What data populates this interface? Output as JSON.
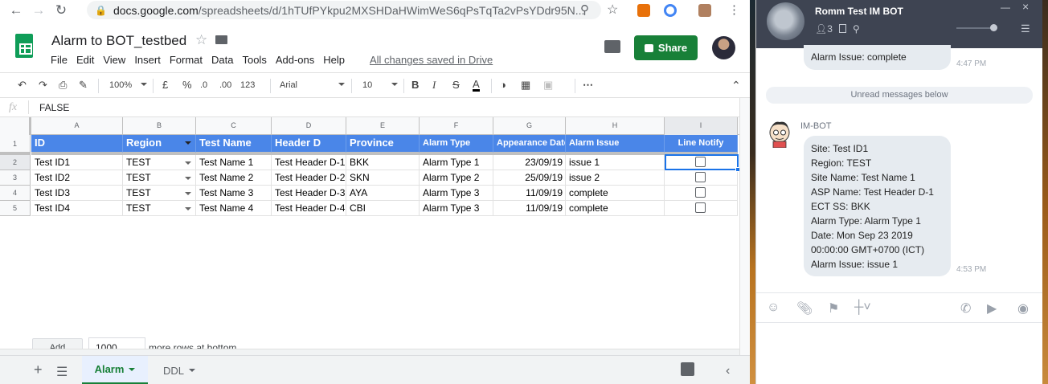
{
  "browser": {
    "url_host": "docs.google.com",
    "url_path": "/spreadsheets/d/1hTUfPYkpu2MXSHDaHWimWeS6qPsTqTa2vPsYDdr95N...",
    "icons": [
      "back-arrow-icon",
      "forward-arrow-icon",
      "reload-icon",
      "lock-icon",
      "zoom-icon",
      "star-icon",
      "kebab-menu-icon"
    ]
  },
  "sheet": {
    "title": "Alarm to BOT_testbed",
    "menu": [
      "File",
      "Edit",
      "View",
      "Insert",
      "Format",
      "Data",
      "Tools",
      "Add-ons",
      "Help"
    ],
    "saved_status": "All changes saved in Drive",
    "share_label": "Share",
    "toolbar": {
      "zoom": "100%",
      "currency": "£",
      "percent": "%",
      "dec_less": ".0",
      "dec_more": ".00",
      "format_more": "123",
      "font": "Arial",
      "font_size": "10",
      "bold": "B",
      "italic": "I",
      "strike": "S",
      "text_color": "A",
      "more": "⋯"
    },
    "formula": {
      "fx": "fx",
      "value": "FALSE"
    },
    "columns": [
      "A",
      "B",
      "C",
      "D",
      "E",
      "F",
      "G",
      "H",
      "I"
    ],
    "rows": [
      "1",
      "2",
      "3",
      "4",
      "5"
    ],
    "header": [
      "ID",
      "Region",
      "Test Name",
      "Header D",
      "Province",
      "Alarm Type",
      "Appearance Date",
      "Alarm Issue",
      "Line Notify"
    ],
    "data": [
      [
        "Test ID1",
        "TEST",
        "Test Name 1",
        "Test Header D-1",
        "BKK",
        "Alarm Type 1",
        "23/09/19",
        "issue 1"
      ],
      [
        "Test ID2",
        "TEST",
        "Test Name 2",
        "Test Header D-2",
        "SKN",
        "Alarm Type 2",
        "25/09/19",
        "issue 2"
      ],
      [
        "Test ID3",
        "TEST",
        "Test Name 3",
        "Test Header D-3",
        "AYA",
        "Alarm Type 3",
        "11/09/19",
        "complete"
      ],
      [
        "Test ID4",
        "TEST",
        "Test Name 4",
        "Test Header D-4",
        "CBI",
        "Alarm Type 3",
        "11/09/19",
        "complete"
      ]
    ],
    "checkbox_states": [
      false,
      false,
      false,
      false
    ],
    "add_rows": {
      "button": "Add",
      "count": "1000",
      "text": "more rows at bottom."
    },
    "tabs": [
      {
        "label": "Alarm",
        "active": true
      },
      {
        "label": "DDL",
        "active": false
      }
    ],
    "colors": {
      "header_fill": "#4a86e8",
      "accent": "#188038",
      "selection": "#1a73e8"
    }
  },
  "chat": {
    "title": "Romm Test IM BOT",
    "member_count": "3",
    "prev_message": "Alarm Issue: complete",
    "prev_time": "4:47 PM",
    "unread_label": "Unread messages below",
    "sender": "IM-BOT",
    "message_lines": [
      "Site: Test ID1",
      "Region: TEST",
      "Site Name: Test Name 1",
      "ASP Name: Test Header D-1",
      "ECT SS: BKK",
      "Alarm Type: Alarm Type 1",
      "Date: Mon Sep 23 2019",
      "00:00:00 GMT+0700 (ICT)",
      "Alarm Issue: issue 1"
    ],
    "message_time": "4:53 PM",
    "tools": [
      "emoji-icon",
      "attach-icon",
      "bookmark-icon",
      "crop-icon",
      "call-icon",
      "video-icon",
      "broadcast-icon"
    ]
  }
}
